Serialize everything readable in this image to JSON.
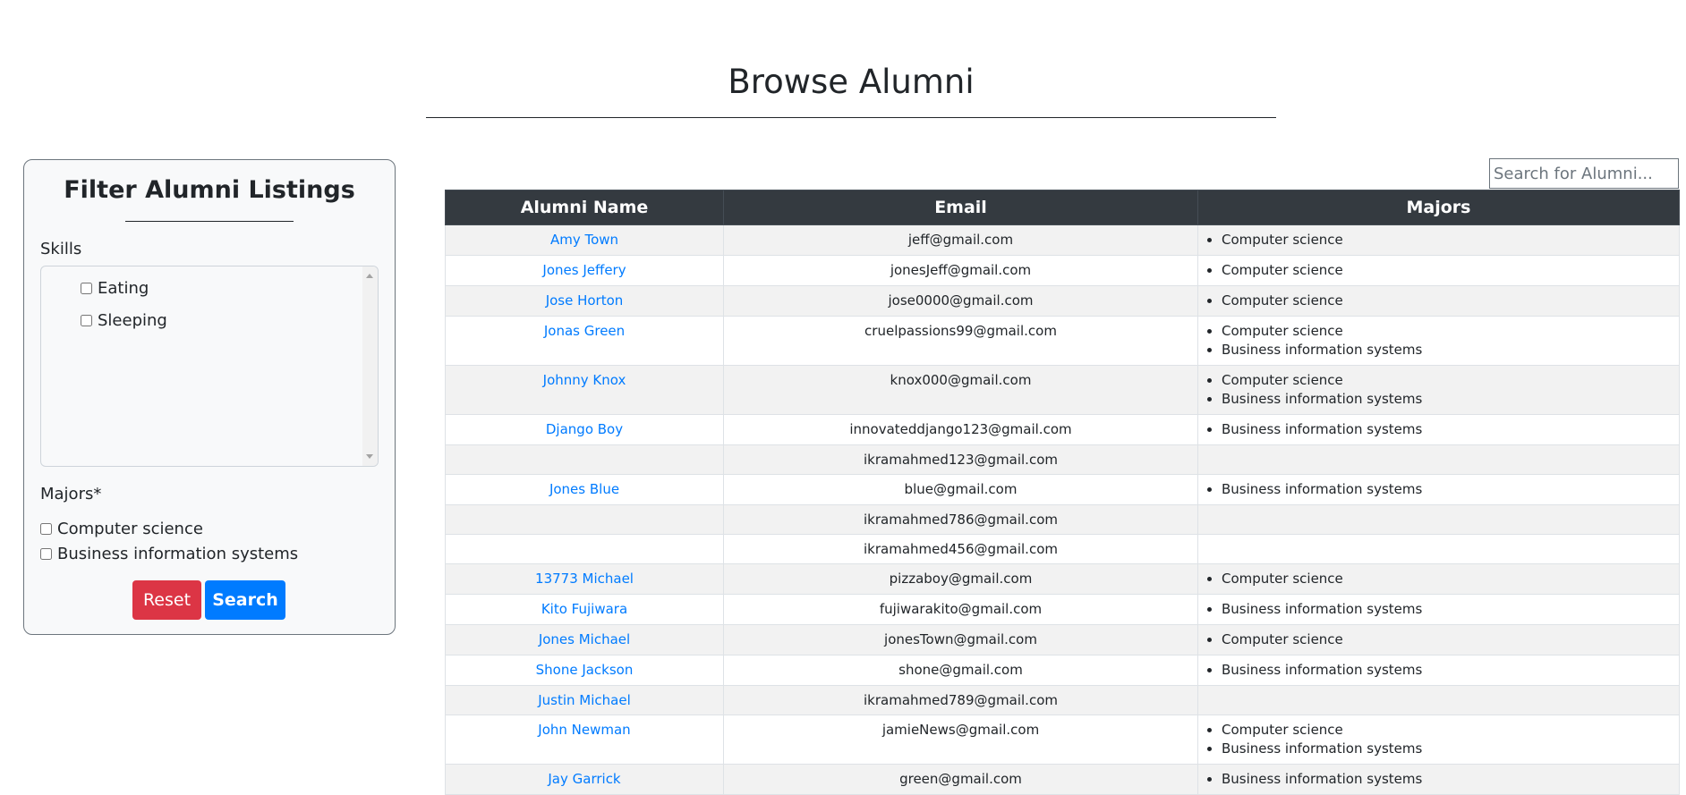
{
  "page": {
    "title": "Browse Alumni"
  },
  "filter": {
    "title": "Filter Alumni Listings",
    "skills_label": "Skills",
    "skills": [
      "Eating",
      "Sleeping"
    ],
    "majors_label": "Majors*",
    "majors": [
      "Computer science",
      "Business information systems"
    ],
    "reset_label": "Reset",
    "search_label": "Search"
  },
  "search": {
    "placeholder": "Search for Alumni..."
  },
  "table": {
    "headers": [
      "Alumni Name",
      "Email",
      "Majors"
    ],
    "rows": [
      {
        "name": "Amy Town",
        "email": "jeff@gmail.com",
        "majors": [
          "Computer science"
        ]
      },
      {
        "name": "Jones Jeffery",
        "email": "jonesJeff@gmail.com",
        "majors": [
          "Computer science"
        ]
      },
      {
        "name": "Jose Horton",
        "email": "jose0000@gmail.com",
        "majors": [
          "Computer science"
        ]
      },
      {
        "name": "Jonas Green",
        "email": "cruelpassions99@gmail.com",
        "majors": [
          "Computer science",
          "Business information systems"
        ]
      },
      {
        "name": "Johnny Knox",
        "email": "knox000@gmail.com",
        "majors": [
          "Computer science",
          "Business information systems"
        ]
      },
      {
        "name": "Django Boy",
        "email": "innovateddjango123@gmail.com",
        "majors": [
          "Business information systems"
        ]
      },
      {
        "name": "",
        "email": "ikramahmed123@gmail.com",
        "majors": []
      },
      {
        "name": "Jones Blue",
        "email": "blue@gmail.com",
        "majors": [
          "Business information systems"
        ]
      },
      {
        "name": "",
        "email": "ikramahmed786@gmail.com",
        "majors": []
      },
      {
        "name": "",
        "email": "ikramahmed456@gmail.com",
        "majors": []
      },
      {
        "name": "13773 Michael",
        "email": "pizzaboy@gmail.com",
        "majors": [
          "Computer science"
        ]
      },
      {
        "name": "Kito Fujiwara",
        "email": "fujiwarakito@gmail.com",
        "majors": [
          "Business information systems"
        ]
      },
      {
        "name": "Jones Michael",
        "email": "jonesTown@gmail.com",
        "majors": [
          "Computer science"
        ]
      },
      {
        "name": "Shone Jackson",
        "email": "shone@gmail.com",
        "majors": [
          "Business information systems"
        ]
      },
      {
        "name": "Justin Michael",
        "email": "ikramahmed789@gmail.com",
        "majors": []
      },
      {
        "name": "John Newman",
        "email": "jamieNews@gmail.com",
        "majors": [
          "Computer science",
          "Business information systems"
        ]
      },
      {
        "name": "Jay Garrick",
        "email": "green@gmail.com",
        "majors": [
          "Business information systems"
        ]
      }
    ]
  },
  "colors": {
    "header_bg": "#343a40",
    "link": "#007bff",
    "reset": "#dc3545",
    "search": "#007bff",
    "stripe": "#f2f2f2"
  }
}
